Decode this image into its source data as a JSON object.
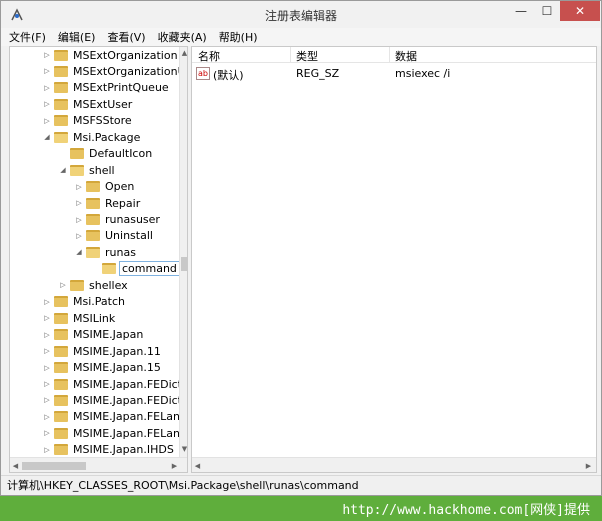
{
  "window": {
    "title": "注册表编辑器",
    "minimize_label": "—",
    "maximize_label": "☐",
    "close_label": "✕"
  },
  "menu": [
    "文件(F)",
    "编辑(E)",
    "查看(V)",
    "收藏夹(A)",
    "帮助(H)"
  ],
  "tree": [
    {
      "label": "MSExtOrganization",
      "level": 1,
      "expander": "▷",
      "open": false,
      "selected": false
    },
    {
      "label": "MSExtOrganizationU",
      "level": 1,
      "expander": "▷",
      "open": false,
      "selected": false
    },
    {
      "label": "MSExtPrintQueue",
      "level": 1,
      "expander": "▷",
      "open": false,
      "selected": false
    },
    {
      "label": "MSExtUser",
      "level": 1,
      "expander": "▷",
      "open": false,
      "selected": false
    },
    {
      "label": "MSFSStore",
      "level": 1,
      "expander": "▷",
      "open": false,
      "selected": false
    },
    {
      "label": "Msi.Package",
      "level": 1,
      "expander": "◢",
      "open": true,
      "selected": false
    },
    {
      "label": "DefaultIcon",
      "level": 2,
      "expander": "",
      "open": false,
      "selected": false
    },
    {
      "label": "shell",
      "level": 2,
      "expander": "◢",
      "open": true,
      "selected": false
    },
    {
      "label": "Open",
      "level": 3,
      "expander": "▷",
      "open": false,
      "selected": false
    },
    {
      "label": "Repair",
      "level": 3,
      "expander": "▷",
      "open": false,
      "selected": false
    },
    {
      "label": "runasuser",
      "level": 3,
      "expander": "▷",
      "open": false,
      "selected": false
    },
    {
      "label": "Uninstall",
      "level": 3,
      "expander": "▷",
      "open": false,
      "selected": false
    },
    {
      "label": "runas",
      "level": 3,
      "expander": "◢",
      "open": true,
      "selected": false
    },
    {
      "label": "command",
      "level": 4,
      "expander": "",
      "open": true,
      "selected": true
    },
    {
      "label": "shellex",
      "level": 2,
      "expander": "▷",
      "open": false,
      "selected": false
    },
    {
      "label": "Msi.Patch",
      "level": 1,
      "expander": "▷",
      "open": false,
      "selected": false
    },
    {
      "label": "MSILink",
      "level": 1,
      "expander": "▷",
      "open": false,
      "selected": false
    },
    {
      "label": "MSIME.Japan",
      "level": 1,
      "expander": "▷",
      "open": false,
      "selected": false
    },
    {
      "label": "MSIME.Japan.11",
      "level": 1,
      "expander": "▷",
      "open": false,
      "selected": false
    },
    {
      "label": "MSIME.Japan.15",
      "level": 1,
      "expander": "▷",
      "open": false,
      "selected": false
    },
    {
      "label": "MSIME.Japan.FEDict",
      "level": 1,
      "expander": "▷",
      "open": false,
      "selected": false
    },
    {
      "label": "MSIME.Japan.FEDict.",
      "level": 1,
      "expander": "▷",
      "open": false,
      "selected": false
    },
    {
      "label": "MSIME.Japan.FELang",
      "level": 1,
      "expander": "▷",
      "open": false,
      "selected": false
    },
    {
      "label": "MSIME.Japan.FELang",
      "level": 1,
      "expander": "▷",
      "open": false,
      "selected": false
    },
    {
      "label": "MSIME.Japan.IHDS",
      "level": 1,
      "expander": "▷",
      "open": false,
      "selected": false
    }
  ],
  "list": {
    "headers": {
      "name": "名称",
      "type": "类型",
      "data": "数据"
    },
    "rows": [
      {
        "icon": "ab",
        "name": "(默认)",
        "type": "REG_SZ",
        "data": "msiexec /i"
      }
    ]
  },
  "status": "计算机\\HKEY_CLASSES_ROOT\\Msi.Package\\shell\\runas\\command",
  "watermark": "http://www.hackhome.com[网侠]提供",
  "colors": {
    "close_button": "#c7504e",
    "watermark_band": "#5fae3c",
    "folder": "#e7c25f",
    "selection_border": "#7fb2e0"
  }
}
